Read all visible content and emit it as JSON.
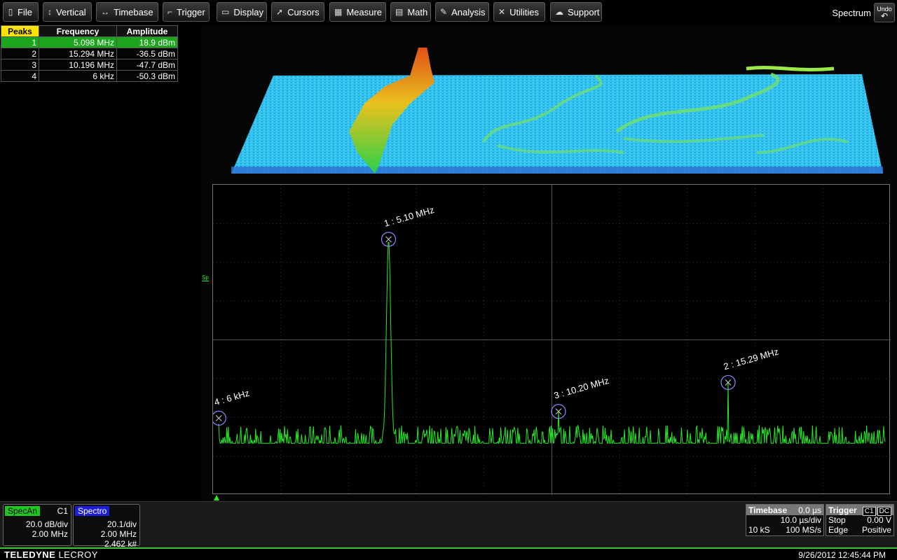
{
  "menubar": {
    "items": [
      {
        "label": "File",
        "icon": "clipboard-icon",
        "glyph": "▯"
      },
      {
        "label": "Vertical",
        "icon": "vertical-arrows-icon",
        "glyph": "↕"
      },
      {
        "label": "Timebase",
        "icon": "horizontal-arrows-icon",
        "glyph": "↔"
      },
      {
        "label": "Trigger",
        "icon": "trigger-flag-icon",
        "glyph": "⌐"
      },
      {
        "label": "Display",
        "icon": "display-icon",
        "glyph": "▭"
      },
      {
        "label": "Cursors",
        "icon": "cursor-arrow-icon",
        "glyph": "➚"
      },
      {
        "label": "Measure",
        "icon": "measure-icon",
        "glyph": "▦"
      },
      {
        "label": "Math",
        "icon": "calculator-icon",
        "glyph": "▤"
      },
      {
        "label": "Analysis",
        "icon": "pencil-icon",
        "glyph": "✎"
      },
      {
        "label": "Utilities",
        "icon": "tools-icon",
        "glyph": "✕"
      },
      {
        "label": "Support",
        "icon": "chat-icon",
        "glyph": "☁"
      }
    ],
    "title": "Spectrum",
    "undo_label": "Undo",
    "undo_glyph": "↶"
  },
  "peaks": {
    "headers": [
      "Peaks",
      "Frequency",
      "Amplitude"
    ],
    "rows": [
      {
        "n": "1",
        "freq": "5.098 MHz",
        "amp": "18.9 dBm"
      },
      {
        "n": "2",
        "freq": "15.294 MHz",
        "amp": "-36.5 dBm"
      },
      {
        "n": "3",
        "freq": "10.196 MHz",
        "amp": "-47.7 dBm"
      },
      {
        "n": "4",
        "freq": "6 kHz",
        "amp": "-50.3 dBm"
      }
    ]
  },
  "trace_label": "Sp",
  "chart_data": {
    "type": "line",
    "x_unit": "MHz",
    "xlim": [
      0,
      20
    ],
    "ylim": [
      -80,
      40
    ],
    "noise_floor": -60,
    "grid": true,
    "grid_divisions": [
      10,
      8
    ],
    "color": "#27e827",
    "markers": [
      {
        "label": "1 : 5.10 MHz",
        "x": 5.1,
        "y": 18.9
      },
      {
        "label": "2 : 15.29 MHz",
        "x": 15.29,
        "y": -36.5
      },
      {
        "label": "3 : 10.20 MHz",
        "x": 10.2,
        "y": -47.7
      },
      {
        "label": "4 : 6 kHz",
        "x": 0.006,
        "y": -50.3
      }
    ]
  },
  "descriptors": {
    "specan": {
      "tag": "SpecAn",
      "source": "C1",
      "line1": "20.0 dB/div",
      "line2": "2.00 MHz",
      "tag_color": "#1ec81e"
    },
    "spectro": {
      "tag": "Spectro",
      "line1": "20.1/div",
      "line2": "2.00 MHz",
      "line3": "2.462 k#",
      "tag_color": "#1e1ed8"
    }
  },
  "timebase": {
    "title": "Timebase",
    "delay": "0.0 µs",
    "tdiv": "10.0 µs/div",
    "samples": "10 kS",
    "rate": "100 MS/s"
  },
  "trigger": {
    "title": "Trigger",
    "ch": "C1",
    "coupling": "DC",
    "mode": "Stop",
    "level": "0.00 V",
    "type": "Edge",
    "slope": "Positive"
  },
  "footer": {
    "brand_bold": "TELEDYNE",
    "brand_rest": " LECROY",
    "datetime": "9/26/2012 12:45:44 PM"
  }
}
